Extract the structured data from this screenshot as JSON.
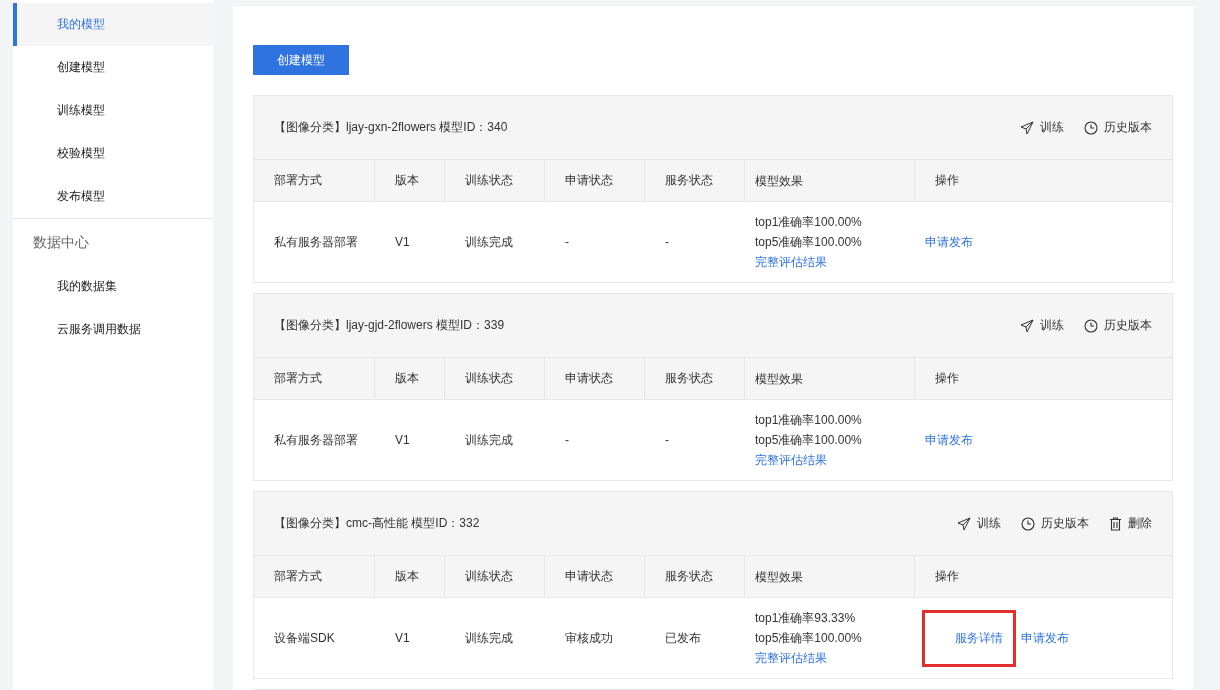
{
  "sidebar": {
    "items": [
      {
        "label": "我的模型",
        "selected": true
      },
      {
        "label": "创建模型",
        "selected": false
      },
      {
        "label": "训练模型",
        "selected": false
      },
      {
        "label": "校验模型",
        "selected": false
      },
      {
        "label": "发布模型",
        "selected": false
      }
    ],
    "groups": [
      {
        "title": "数据中心",
        "items": [
          {
            "label": "我的数据集",
            "selected": false
          },
          {
            "label": "云服务调用数据",
            "selected": false
          }
        ]
      }
    ]
  },
  "create_button": "创建模型",
  "models": [
    {
      "title": "【图像分类】ljay-gxn-2flowers 模型ID：340",
      "actions": [
        {
          "kind": "train",
          "label": "训练"
        },
        {
          "kind": "history",
          "label": "历史版本"
        }
      ],
      "columns": [
        "部署方式",
        "版本",
        "训练状态",
        "申请状态",
        "服务状态",
        "模型效果",
        "操作"
      ],
      "rows": [
        {
          "deploy": "私有服务器部署",
          "version": "V1",
          "train_status": "训练完成",
          "apply_status": "-",
          "service_status": "-",
          "effect": [
            "top1准确率100.00%",
            "top5准确率100.00%"
          ],
          "effect_link": "完整评估结果",
          "operations": [
            {
              "label": "申请发布",
              "highlighted": false
            }
          ]
        }
      ]
    },
    {
      "title": "【图像分类】ljay-gjd-2flowers 模型ID：339",
      "actions": [
        {
          "kind": "train",
          "label": "训练"
        },
        {
          "kind": "history",
          "label": "历史版本"
        }
      ],
      "columns": [
        "部署方式",
        "版本",
        "训练状态",
        "申请状态",
        "服务状态",
        "模型效果",
        "操作"
      ],
      "rows": [
        {
          "deploy": "私有服务器部署",
          "version": "V1",
          "train_status": "训练完成",
          "apply_status": "-",
          "service_status": "-",
          "effect": [
            "top1准确率100.00%",
            "top5准确率100.00%"
          ],
          "effect_link": "完整评估结果",
          "operations": [
            {
              "label": "申请发布",
              "highlighted": false
            }
          ]
        }
      ]
    },
    {
      "title": "【图像分类】cmc-高性能 模型ID：332",
      "actions": [
        {
          "kind": "train",
          "label": "训练"
        },
        {
          "kind": "history",
          "label": "历史版本"
        },
        {
          "kind": "delete",
          "label": "删除"
        }
      ],
      "columns": [
        "部署方式",
        "版本",
        "训练状态",
        "申请状态",
        "服务状态",
        "模型效果",
        "操作"
      ],
      "rows": [
        {
          "deploy": "设备端SDK",
          "version": "V1",
          "train_status": "训练完成",
          "apply_status": "审核成功",
          "service_status": "已发布",
          "effect": [
            "top1准确率93.33%",
            "top5准确率100.00%"
          ],
          "effect_link": "完整评估结果",
          "operations": [
            {
              "label": "服务详情",
              "highlighted": true
            },
            {
              "label": "申请发布",
              "highlighted": false
            }
          ]
        }
      ]
    }
  ]
}
